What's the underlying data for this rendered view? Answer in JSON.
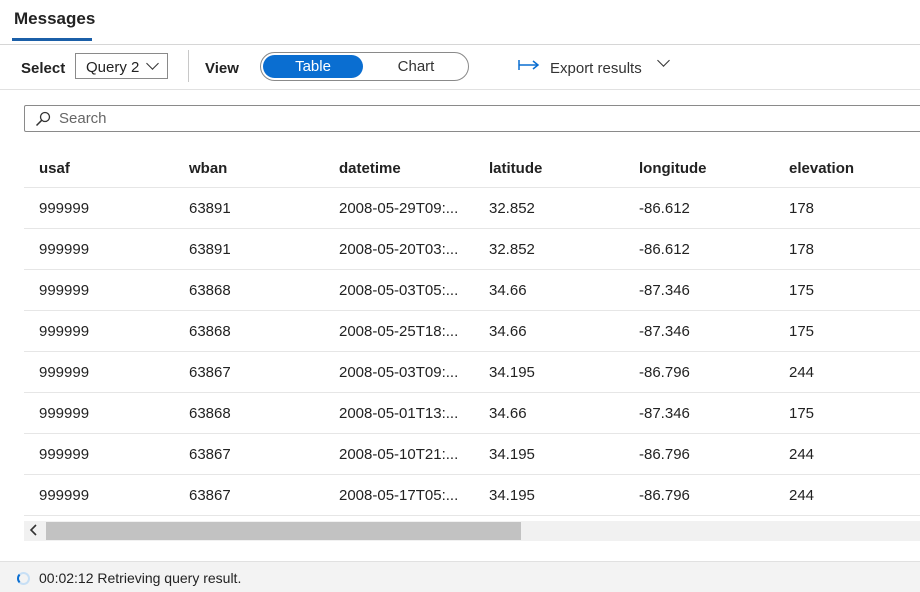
{
  "tabs": {
    "messages": "Messages"
  },
  "toolbar": {
    "select_label": "Select",
    "query_value": "Query 2",
    "view_label": "View",
    "view_options": [
      "Table",
      "Chart"
    ],
    "view_selected": "Table",
    "export_label": "Export results",
    "accent_color": "#0a6ed1"
  },
  "search": {
    "placeholder": "Search",
    "value": ""
  },
  "table": {
    "columns": [
      "usaf",
      "wban",
      "datetime",
      "latitude",
      "longitude",
      "elevation"
    ],
    "rows": [
      [
        "999999",
        "63891",
        "2008-05-29T09:...",
        "32.852",
        "-86.612",
        "178"
      ],
      [
        "999999",
        "63891",
        "2008-05-20T03:...",
        "32.852",
        "-86.612",
        "178"
      ],
      [
        "999999",
        "63868",
        "2008-05-03T05:...",
        "34.66",
        "-87.346",
        "175"
      ],
      [
        "999999",
        "63868",
        "2008-05-25T18:...",
        "34.66",
        "-87.346",
        "175"
      ],
      [
        "999999",
        "63867",
        "2008-05-03T09:...",
        "34.195",
        "-86.796",
        "244"
      ],
      [
        "999999",
        "63868",
        "2008-05-01T13:...",
        "34.66",
        "-87.346",
        "175"
      ],
      [
        "999999",
        "63867",
        "2008-05-10T21:...",
        "34.195",
        "-86.796",
        "244"
      ],
      [
        "999999",
        "63867",
        "2008-05-17T05:...",
        "34.195",
        "-86.796",
        "244"
      ]
    ]
  },
  "status": {
    "text": "00:02:12 Retrieving query result."
  },
  "icons": {
    "search": "search-icon",
    "export": "export-arrow-icon",
    "chevron": "chevron-down-icon",
    "scroll": "scroll-left-icon",
    "spinner": "loading-spinner-icon"
  }
}
